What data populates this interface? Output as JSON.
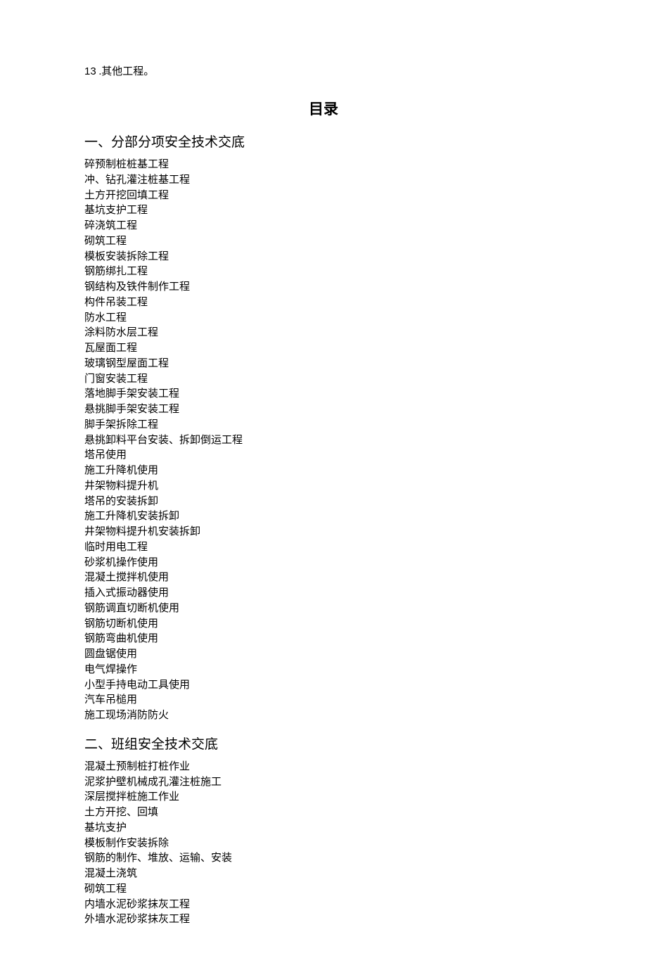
{
  "top_line_num": "13",
  "top_line_text": " .其他工程。",
  "title": "目录",
  "sections": [
    {
      "heading": "一、分部分项安全技术交底",
      "items": [
        "碎预制桩桩基工程",
        "冲、钻孔灌注桩基工程",
        "土方开挖回填工程",
        "基坑支护工程",
        "碎浇筑工程",
        "砌筑工程",
        "模板安装拆除工程",
        "钢筋绑扎工程",
        "钢结构及铁件制作工程",
        "构件吊装工程",
        "防水工程",
        "涂料防水层工程",
        "瓦屋面工程",
        "玻璃钢型屋面工程",
        "门窗安装工程",
        "落地脚手架安装工程",
        "悬挑脚手架安装工程",
        "脚手架拆除工程",
        "悬挑卸料平台安装、拆卸倒运工程",
        "塔吊使用",
        "施工升降机使用",
        "井架物料提升机",
        "塔吊的安装拆卸",
        "施工升降机安装拆卸",
        "井架物料提升机安装拆卸",
        "临时用电工程",
        "砂浆机操作使用",
        "混凝土搅拌机使用",
        "插入式振动器使用",
        "钢筋调直切断机使用",
        "钢筋切断机使用",
        "钢筋弯曲机使用",
        "圆盘锯使用",
        "电气焊操作",
        "小型手持电动工具使用",
        "汽车吊槌用",
        "施工现场消防防火"
      ]
    },
    {
      "heading": "二、班组安全技术交底",
      "items": [
        "混凝土预制桩打桩作业",
        "泥浆护壁机械成孔灌注桩施工",
        "深层搅拌桩施工作业",
        "土方开挖、回填",
        "基坑支护",
        "模板制作安装拆除",
        "钢筋的制作、堆放、运输、安装",
        "混凝土浇筑",
        "砌筑工程",
        "内墙水泥砂浆抹灰工程",
        "外墙水泥砂浆抹灰工程"
      ]
    }
  ]
}
